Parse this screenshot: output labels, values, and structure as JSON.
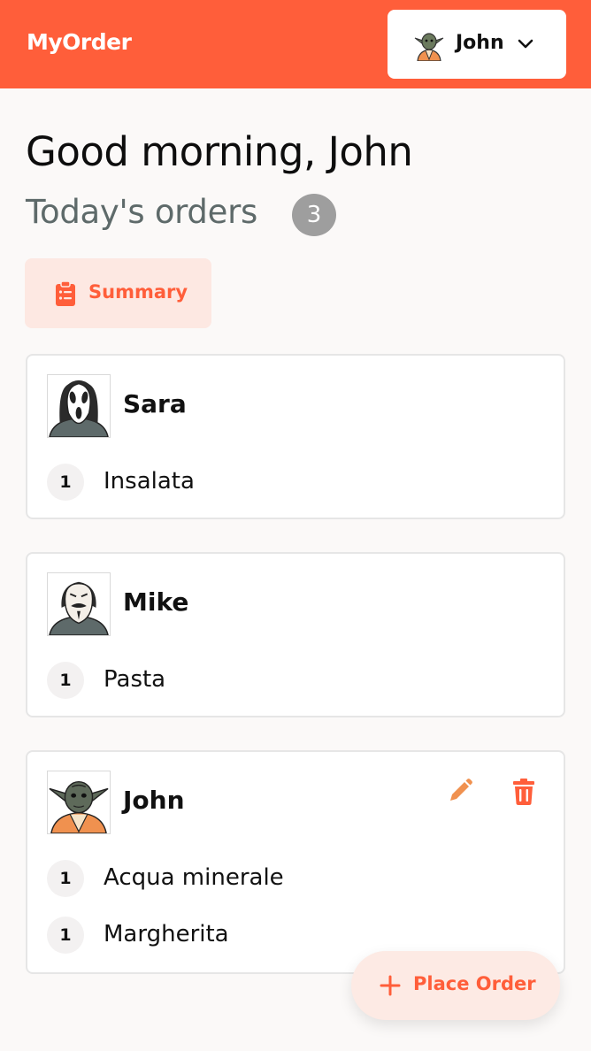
{
  "app": {
    "brand": "MyOrder"
  },
  "user_menu": {
    "name": "John",
    "avatar_icon": "yoda-avatar-icon"
  },
  "greeting": "Good morning, John",
  "orders_header": {
    "label": "Today's orders",
    "count": "3"
  },
  "summary_button": {
    "label": "Summary",
    "icon": "clipboard-icon"
  },
  "orders": [
    {
      "name": "Sara",
      "avatar": "ghostface-avatar-icon",
      "items": [
        {
          "qty": "1",
          "name": "Insalata"
        }
      ]
    },
    {
      "name": "Mike",
      "avatar": "guy-fawkes-avatar-icon",
      "items": [
        {
          "qty": "1",
          "name": "Pasta"
        }
      ]
    },
    {
      "name": "John",
      "avatar": "yoda-avatar-icon",
      "editable": true,
      "items": [
        {
          "qty": "1",
          "name": "Acqua minerale"
        },
        {
          "qty": "1",
          "name": "Margherita"
        }
      ]
    }
  ],
  "place_order_button": {
    "label": "Place Order",
    "icon": "plus-icon"
  },
  "colors": {
    "accent": "#ff5e3a",
    "accent_soft": "#fde8e2",
    "muted_text": "#5e6a6a",
    "badge": "#9e9e9e"
  }
}
